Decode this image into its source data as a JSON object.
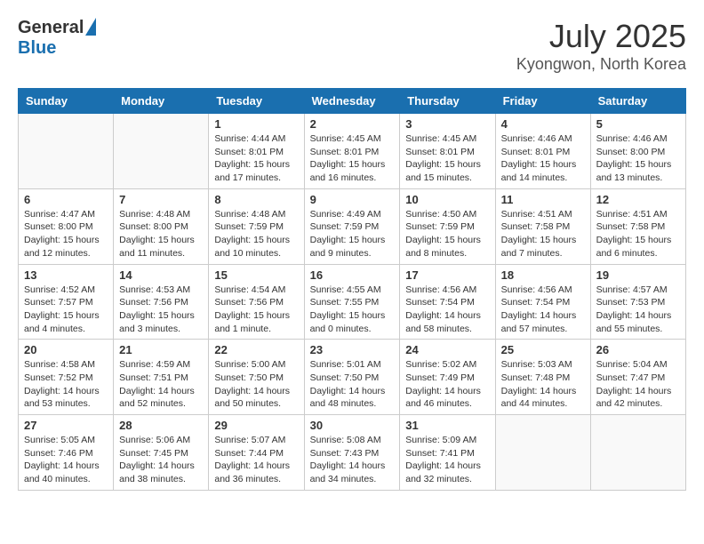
{
  "header": {
    "logo_general": "General",
    "logo_blue": "Blue",
    "month": "July 2025",
    "location": "Kyongwon, North Korea"
  },
  "weekdays": [
    "Sunday",
    "Monday",
    "Tuesday",
    "Wednesday",
    "Thursday",
    "Friday",
    "Saturday"
  ],
  "weeks": [
    [
      {
        "day": "",
        "info": ""
      },
      {
        "day": "",
        "info": ""
      },
      {
        "day": "1",
        "info": "Sunrise: 4:44 AM\nSunset: 8:01 PM\nDaylight: 15 hours and 17 minutes."
      },
      {
        "day": "2",
        "info": "Sunrise: 4:45 AM\nSunset: 8:01 PM\nDaylight: 15 hours and 16 minutes."
      },
      {
        "day": "3",
        "info": "Sunrise: 4:45 AM\nSunset: 8:01 PM\nDaylight: 15 hours and 15 minutes."
      },
      {
        "day": "4",
        "info": "Sunrise: 4:46 AM\nSunset: 8:01 PM\nDaylight: 15 hours and 14 minutes."
      },
      {
        "day": "5",
        "info": "Sunrise: 4:46 AM\nSunset: 8:00 PM\nDaylight: 15 hours and 13 minutes."
      }
    ],
    [
      {
        "day": "6",
        "info": "Sunrise: 4:47 AM\nSunset: 8:00 PM\nDaylight: 15 hours and 12 minutes."
      },
      {
        "day": "7",
        "info": "Sunrise: 4:48 AM\nSunset: 8:00 PM\nDaylight: 15 hours and 11 minutes."
      },
      {
        "day": "8",
        "info": "Sunrise: 4:48 AM\nSunset: 7:59 PM\nDaylight: 15 hours and 10 minutes."
      },
      {
        "day": "9",
        "info": "Sunrise: 4:49 AM\nSunset: 7:59 PM\nDaylight: 15 hours and 9 minutes."
      },
      {
        "day": "10",
        "info": "Sunrise: 4:50 AM\nSunset: 7:59 PM\nDaylight: 15 hours and 8 minutes."
      },
      {
        "day": "11",
        "info": "Sunrise: 4:51 AM\nSunset: 7:58 PM\nDaylight: 15 hours and 7 minutes."
      },
      {
        "day": "12",
        "info": "Sunrise: 4:51 AM\nSunset: 7:58 PM\nDaylight: 15 hours and 6 minutes."
      }
    ],
    [
      {
        "day": "13",
        "info": "Sunrise: 4:52 AM\nSunset: 7:57 PM\nDaylight: 15 hours and 4 minutes."
      },
      {
        "day": "14",
        "info": "Sunrise: 4:53 AM\nSunset: 7:56 PM\nDaylight: 15 hours and 3 minutes."
      },
      {
        "day": "15",
        "info": "Sunrise: 4:54 AM\nSunset: 7:56 PM\nDaylight: 15 hours and 1 minute."
      },
      {
        "day": "16",
        "info": "Sunrise: 4:55 AM\nSunset: 7:55 PM\nDaylight: 15 hours and 0 minutes."
      },
      {
        "day": "17",
        "info": "Sunrise: 4:56 AM\nSunset: 7:54 PM\nDaylight: 14 hours and 58 minutes."
      },
      {
        "day": "18",
        "info": "Sunrise: 4:56 AM\nSunset: 7:54 PM\nDaylight: 14 hours and 57 minutes."
      },
      {
        "day": "19",
        "info": "Sunrise: 4:57 AM\nSunset: 7:53 PM\nDaylight: 14 hours and 55 minutes."
      }
    ],
    [
      {
        "day": "20",
        "info": "Sunrise: 4:58 AM\nSunset: 7:52 PM\nDaylight: 14 hours and 53 minutes."
      },
      {
        "day": "21",
        "info": "Sunrise: 4:59 AM\nSunset: 7:51 PM\nDaylight: 14 hours and 52 minutes."
      },
      {
        "day": "22",
        "info": "Sunrise: 5:00 AM\nSunset: 7:50 PM\nDaylight: 14 hours and 50 minutes."
      },
      {
        "day": "23",
        "info": "Sunrise: 5:01 AM\nSunset: 7:50 PM\nDaylight: 14 hours and 48 minutes."
      },
      {
        "day": "24",
        "info": "Sunrise: 5:02 AM\nSunset: 7:49 PM\nDaylight: 14 hours and 46 minutes."
      },
      {
        "day": "25",
        "info": "Sunrise: 5:03 AM\nSunset: 7:48 PM\nDaylight: 14 hours and 44 minutes."
      },
      {
        "day": "26",
        "info": "Sunrise: 5:04 AM\nSunset: 7:47 PM\nDaylight: 14 hours and 42 minutes."
      }
    ],
    [
      {
        "day": "27",
        "info": "Sunrise: 5:05 AM\nSunset: 7:46 PM\nDaylight: 14 hours and 40 minutes."
      },
      {
        "day": "28",
        "info": "Sunrise: 5:06 AM\nSunset: 7:45 PM\nDaylight: 14 hours and 38 minutes."
      },
      {
        "day": "29",
        "info": "Sunrise: 5:07 AM\nSunset: 7:44 PM\nDaylight: 14 hours and 36 minutes."
      },
      {
        "day": "30",
        "info": "Sunrise: 5:08 AM\nSunset: 7:43 PM\nDaylight: 14 hours and 34 minutes."
      },
      {
        "day": "31",
        "info": "Sunrise: 5:09 AM\nSunset: 7:41 PM\nDaylight: 14 hours and 32 minutes."
      },
      {
        "day": "",
        "info": ""
      },
      {
        "day": "",
        "info": ""
      }
    ]
  ]
}
